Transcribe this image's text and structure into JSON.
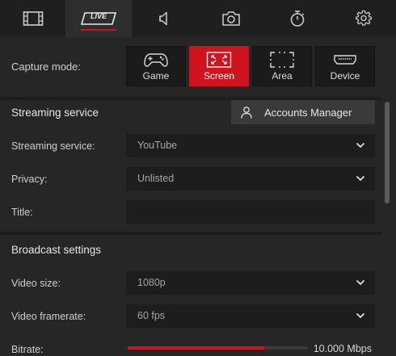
{
  "tabs": [
    {
      "icon": "film-icon"
    },
    {
      "icon": "live-icon",
      "label": "LIVE",
      "active": true
    },
    {
      "icon": "speaker-icon"
    },
    {
      "icon": "camera-icon"
    },
    {
      "icon": "stopwatch-icon"
    },
    {
      "icon": "gear-icon"
    }
  ],
  "capture": {
    "label": "Capture mode:",
    "modes": [
      {
        "label": "Game",
        "icon": "gamepad-icon"
      },
      {
        "label": "Screen",
        "icon": "fullscreen-icon",
        "active": true
      },
      {
        "label": "Area",
        "icon": "area-select-icon"
      },
      {
        "label": "Device",
        "icon": "hdmi-icon"
      }
    ]
  },
  "streaming": {
    "section_title": "Streaming service",
    "accounts_label": "Accounts Manager",
    "service_label": "Streaming service:",
    "service_value": "YouTube",
    "privacy_label": "Privacy:",
    "privacy_value": "Unlisted",
    "title_label": "Title:",
    "title_value": ""
  },
  "broadcast": {
    "section_title": "Broadcast settings",
    "video_size_label": "Video size:",
    "video_size_value": "1080p",
    "framerate_label": "Video framerate:",
    "framerate_value": "60 fps",
    "bitrate_label": "Bitrate:",
    "bitrate_value": "10.000 Mbps",
    "bitrate_fraction": 0.76
  },
  "colors": {
    "accent": "#d0141f",
    "background": "#262626",
    "field": "#1d1d1d"
  }
}
